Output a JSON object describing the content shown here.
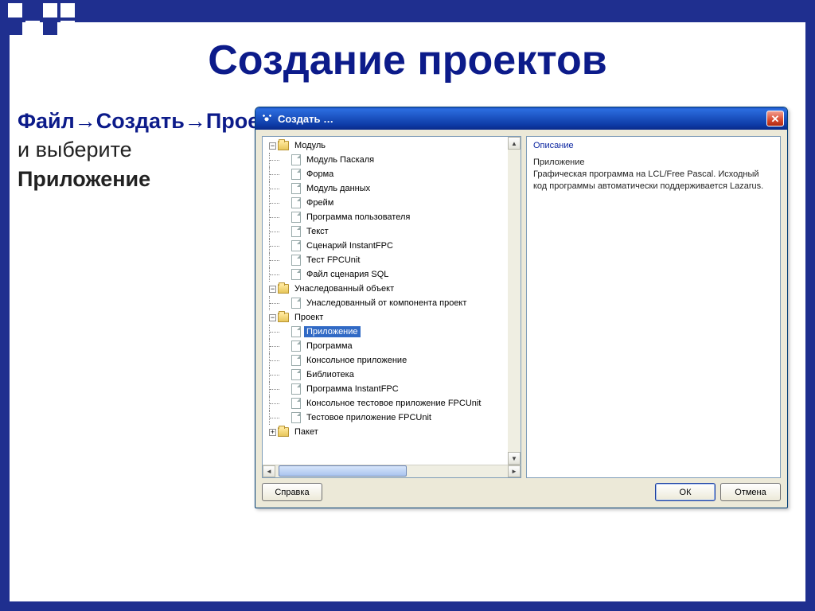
{
  "slide": {
    "title": "Создание проектов",
    "instruction_bold1": "Файл→Создать→Проект",
    "instruction_mid": " и выберите ",
    "instruction_bold2": "Приложение"
  },
  "dialog": {
    "title": "Создать …",
    "desc_heading": "Описание",
    "desc_name": "Приложение",
    "desc_body": "Графическая программа на LCL/Free Pascal. Исходный код программы автоматически поддерживается Lazarus.",
    "buttons": {
      "help": "Справка",
      "ok": "ОК",
      "cancel": "Отмена"
    },
    "tree": [
      {
        "kind": "folder",
        "level": 0,
        "exp": "-",
        "label": "Модуль"
      },
      {
        "kind": "file",
        "level": 1,
        "label": "Модуль Паскаля"
      },
      {
        "kind": "file",
        "level": 1,
        "label": "Форма"
      },
      {
        "kind": "file",
        "level": 1,
        "label": "Модуль данных"
      },
      {
        "kind": "file",
        "level": 1,
        "label": "Фрейм"
      },
      {
        "kind": "file",
        "level": 1,
        "label": "Программа пользователя"
      },
      {
        "kind": "file",
        "level": 1,
        "label": "Текст"
      },
      {
        "kind": "file",
        "level": 1,
        "label": "Сценарий InstantFPC"
      },
      {
        "kind": "file",
        "level": 1,
        "label": "Тест FPCUnit"
      },
      {
        "kind": "file",
        "level": 1,
        "label": "Файл сценария SQL"
      },
      {
        "kind": "folder",
        "level": 0,
        "exp": "-",
        "label": "Унаследованный объект"
      },
      {
        "kind": "file",
        "level": 1,
        "label": "Унаследованный от компонента проект"
      },
      {
        "kind": "folder",
        "level": 0,
        "exp": "-",
        "label": "Проект"
      },
      {
        "kind": "file",
        "level": 1,
        "label": "Приложение",
        "selected": true
      },
      {
        "kind": "file",
        "level": 1,
        "label": "Программа"
      },
      {
        "kind": "file",
        "level": 1,
        "label": "Консольное приложение"
      },
      {
        "kind": "file",
        "level": 1,
        "label": "Библиотека"
      },
      {
        "kind": "file",
        "level": 1,
        "label": "Программа InstantFPC"
      },
      {
        "kind": "file",
        "level": 1,
        "label": "Консольное тестовое приложение FPCUnit"
      },
      {
        "kind": "file",
        "level": 1,
        "label": "Тестовое приложение FPCUnit"
      },
      {
        "kind": "folder",
        "level": 0,
        "exp": "+",
        "label": "Пакет"
      }
    ]
  }
}
